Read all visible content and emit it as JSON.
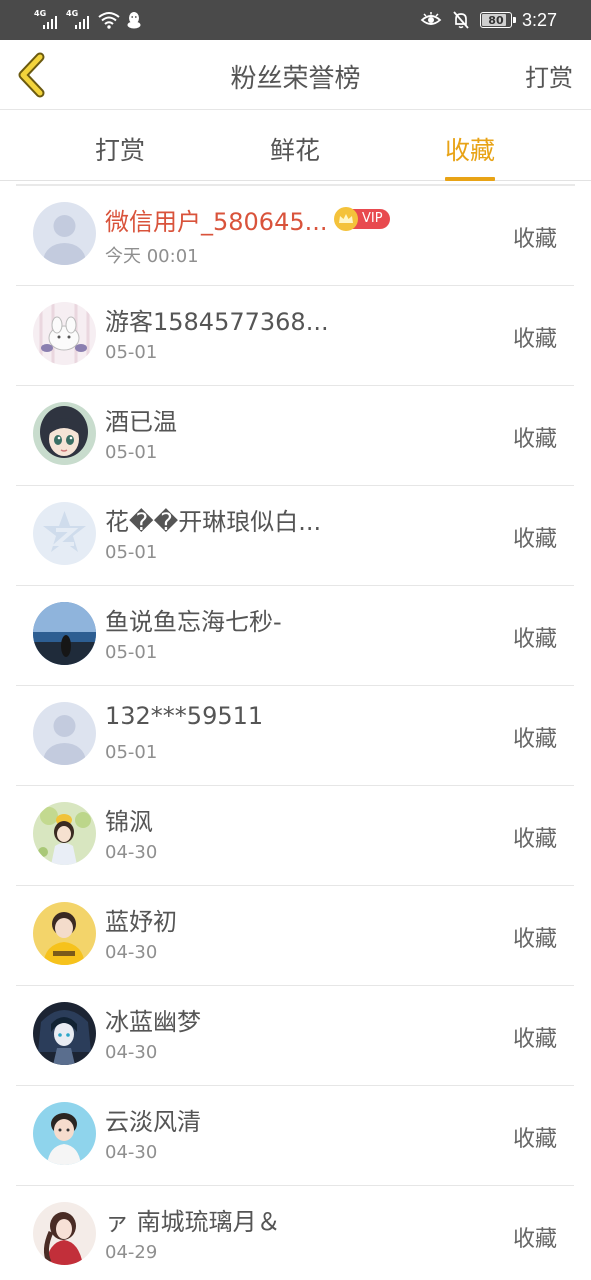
{
  "status_bar": {
    "net1": "4G",
    "net2": "4G",
    "battery": "80",
    "time": "3:27"
  },
  "header": {
    "title": "粉丝荣誉榜",
    "right_action": "打赏"
  },
  "tabs": [
    {
      "label": "打赏"
    },
    {
      "label": "鲜花"
    },
    {
      "label": "收藏"
    }
  ],
  "vip_label": "VIP",
  "rows": [
    {
      "name": "微信用户_580645...",
      "date": "今天 00:01",
      "action": "收藏"
    },
    {
      "name": "游客1584577368...",
      "date": "05-01",
      "action": "收藏"
    },
    {
      "name": "酒已温",
      "date": "05-01",
      "action": "收藏"
    },
    {
      "name": "花��开琳琅似白...",
      "date": "05-01",
      "action": "收藏"
    },
    {
      "name": "鱼说鱼忘海七秒-",
      "date": "05-01",
      "action": "收藏"
    },
    {
      "name": "132***59511",
      "date": "05-01",
      "action": "收藏"
    },
    {
      "name": "锦沨",
      "date": "04-30",
      "action": "收藏"
    },
    {
      "name": "蓝妤初",
      "date": "04-30",
      "action": "收藏"
    },
    {
      "name": "冰蓝幽梦",
      "date": "04-30",
      "action": "收藏"
    },
    {
      "name": "云淡风清",
      "date": "04-30",
      "action": "收藏"
    },
    {
      "name": "ァ 南城琉璃月＆",
      "date": "04-29",
      "action": "收藏"
    }
  ],
  "colors": {
    "accent": "#e8a316",
    "vip_name": "#d9533b",
    "vip_badge": "#e84a4f",
    "status_bar": "#4a4a4a"
  }
}
